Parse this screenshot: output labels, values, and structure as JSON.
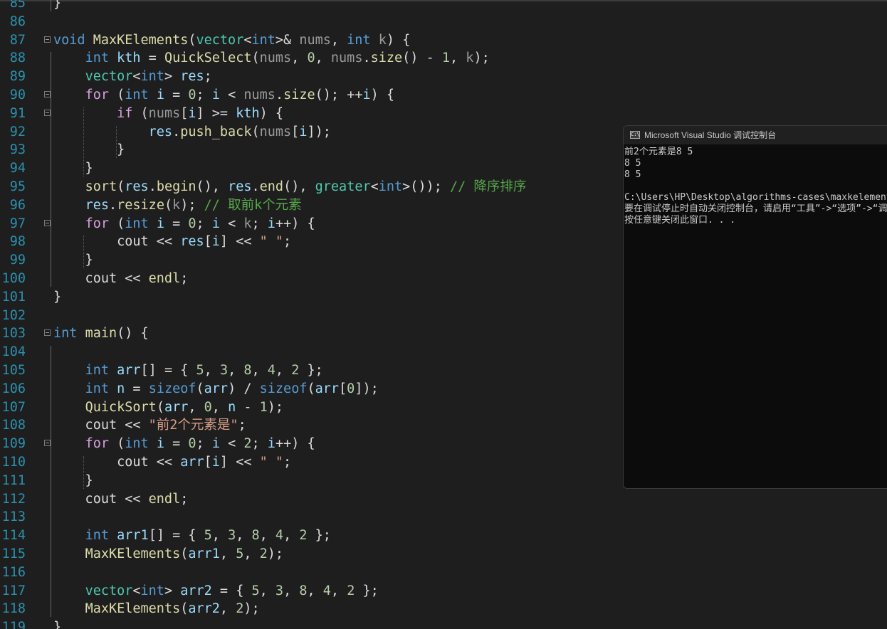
{
  "editor": {
    "line_numbers": [
      "85",
      "86",
      "87",
      "88",
      "89",
      "90",
      "91",
      "92",
      "93",
      "94",
      "95",
      "96",
      "97",
      "98",
      "99",
      "100",
      "101",
      "102",
      "103",
      "104",
      "105",
      "106",
      "107",
      "108",
      "109",
      "110",
      "111",
      "112",
      "113",
      "114",
      "115",
      "116",
      "117",
      "118",
      "119"
    ],
    "lines": [
      [
        {
          "t": "}",
          "c": "plain"
        }
      ],
      [],
      [
        {
          "t": "void",
          "c": "kw"
        },
        {
          "t": " ",
          "c": "plain"
        },
        {
          "t": "MaxKElements",
          "c": "fn"
        },
        {
          "t": "(",
          "c": "plain"
        },
        {
          "t": "vector",
          "c": "ty"
        },
        {
          "t": "<",
          "c": "plain"
        },
        {
          "t": "int",
          "c": "kw"
        },
        {
          "t": ">& ",
          "c": "plain"
        },
        {
          "t": "nums",
          "c": "prm"
        },
        {
          "t": ", ",
          "c": "plain"
        },
        {
          "t": "int",
          "c": "kw"
        },
        {
          "t": " ",
          "c": "plain"
        },
        {
          "t": "k",
          "c": "prm"
        },
        {
          "t": ") {",
          "c": "plain"
        }
      ],
      [
        {
          "t": "    ",
          "c": "plain"
        },
        {
          "t": "int",
          "c": "kw"
        },
        {
          "t": " ",
          "c": "plain"
        },
        {
          "t": "kth",
          "c": "var"
        },
        {
          "t": " = ",
          "c": "plain"
        },
        {
          "t": "QuickSelect",
          "c": "fn"
        },
        {
          "t": "(",
          "c": "plain"
        },
        {
          "t": "nums",
          "c": "prm"
        },
        {
          "t": ", ",
          "c": "plain"
        },
        {
          "t": "0",
          "c": "num"
        },
        {
          "t": ", ",
          "c": "plain"
        },
        {
          "t": "nums",
          "c": "prm"
        },
        {
          "t": ".",
          "c": "plain"
        },
        {
          "t": "size",
          "c": "fn"
        },
        {
          "t": "() - ",
          "c": "plain"
        },
        {
          "t": "1",
          "c": "num"
        },
        {
          "t": ", ",
          "c": "plain"
        },
        {
          "t": "k",
          "c": "prm"
        },
        {
          "t": ");",
          "c": "plain"
        }
      ],
      [
        {
          "t": "    ",
          "c": "plain"
        },
        {
          "t": "vector",
          "c": "ty"
        },
        {
          "t": "<",
          "c": "plain"
        },
        {
          "t": "int",
          "c": "kw"
        },
        {
          "t": "> ",
          "c": "plain"
        },
        {
          "t": "res",
          "c": "var"
        },
        {
          "t": ";",
          "c": "plain"
        }
      ],
      [
        {
          "t": "    ",
          "c": "plain"
        },
        {
          "t": "for",
          "c": "kwc"
        },
        {
          "t": " (",
          "c": "plain"
        },
        {
          "t": "int",
          "c": "kw"
        },
        {
          "t": " ",
          "c": "plain"
        },
        {
          "t": "i",
          "c": "var"
        },
        {
          "t": " = ",
          "c": "plain"
        },
        {
          "t": "0",
          "c": "num"
        },
        {
          "t": "; ",
          "c": "plain"
        },
        {
          "t": "i",
          "c": "var"
        },
        {
          "t": " < ",
          "c": "plain"
        },
        {
          "t": "nums",
          "c": "prm"
        },
        {
          "t": ".",
          "c": "plain"
        },
        {
          "t": "size",
          "c": "fn"
        },
        {
          "t": "(); ++",
          "c": "plain"
        },
        {
          "t": "i",
          "c": "var"
        },
        {
          "t": ") {",
          "c": "plain"
        }
      ],
      [
        {
          "t": "        ",
          "c": "plain"
        },
        {
          "t": "if",
          "c": "kwc"
        },
        {
          "t": " (",
          "c": "plain"
        },
        {
          "t": "nums",
          "c": "prm"
        },
        {
          "t": "[",
          "c": "plain"
        },
        {
          "t": "i",
          "c": "var"
        },
        {
          "t": "] >= ",
          "c": "plain"
        },
        {
          "t": "kth",
          "c": "var"
        },
        {
          "t": ") {",
          "c": "plain"
        }
      ],
      [
        {
          "t": "            ",
          "c": "plain"
        },
        {
          "t": "res",
          "c": "var"
        },
        {
          "t": ".",
          "c": "plain"
        },
        {
          "t": "push_back",
          "c": "fn"
        },
        {
          "t": "(",
          "c": "plain"
        },
        {
          "t": "nums",
          "c": "prm"
        },
        {
          "t": "[",
          "c": "plain"
        },
        {
          "t": "i",
          "c": "var"
        },
        {
          "t": "]);",
          "c": "plain"
        }
      ],
      [
        {
          "t": "        }",
          "c": "plain"
        }
      ],
      [
        {
          "t": "    }",
          "c": "plain"
        }
      ],
      [
        {
          "t": "    ",
          "c": "plain"
        },
        {
          "t": "sort",
          "c": "fn"
        },
        {
          "t": "(",
          "c": "plain"
        },
        {
          "t": "res",
          "c": "var"
        },
        {
          "t": ".",
          "c": "plain"
        },
        {
          "t": "begin",
          "c": "fn"
        },
        {
          "t": "(), ",
          "c": "plain"
        },
        {
          "t": "res",
          "c": "var"
        },
        {
          "t": ".",
          "c": "plain"
        },
        {
          "t": "end",
          "c": "fn"
        },
        {
          "t": "(), ",
          "c": "plain"
        },
        {
          "t": "greater",
          "c": "ty"
        },
        {
          "t": "<",
          "c": "plain"
        },
        {
          "t": "int",
          "c": "kw"
        },
        {
          "t": ">()); ",
          "c": "plain"
        },
        {
          "t": "// 降序排序",
          "c": "cm"
        }
      ],
      [
        {
          "t": "    ",
          "c": "plain"
        },
        {
          "t": "res",
          "c": "var"
        },
        {
          "t": ".",
          "c": "plain"
        },
        {
          "t": "resize",
          "c": "fn"
        },
        {
          "t": "(",
          "c": "plain"
        },
        {
          "t": "k",
          "c": "prm"
        },
        {
          "t": "); ",
          "c": "plain"
        },
        {
          "t": "// 取前k个元素",
          "c": "cm"
        }
      ],
      [
        {
          "t": "    ",
          "c": "plain"
        },
        {
          "t": "for",
          "c": "kwc"
        },
        {
          "t": " (",
          "c": "plain"
        },
        {
          "t": "int",
          "c": "kw"
        },
        {
          "t": " ",
          "c": "plain"
        },
        {
          "t": "i",
          "c": "var"
        },
        {
          "t": " = ",
          "c": "plain"
        },
        {
          "t": "0",
          "c": "num"
        },
        {
          "t": "; ",
          "c": "plain"
        },
        {
          "t": "i",
          "c": "var"
        },
        {
          "t": " < ",
          "c": "plain"
        },
        {
          "t": "k",
          "c": "prm"
        },
        {
          "t": "; ",
          "c": "plain"
        },
        {
          "t": "i",
          "c": "var"
        },
        {
          "t": "++) {",
          "c": "plain"
        }
      ],
      [
        {
          "t": "        cout << ",
          "c": "plain"
        },
        {
          "t": "res",
          "c": "var"
        },
        {
          "t": "[",
          "c": "plain"
        },
        {
          "t": "i",
          "c": "var"
        },
        {
          "t": "] << ",
          "c": "plain"
        },
        {
          "t": "\" \"",
          "c": "str"
        },
        {
          "t": ";",
          "c": "plain"
        }
      ],
      [
        {
          "t": "    }",
          "c": "plain"
        }
      ],
      [
        {
          "t": "    cout << ",
          "c": "plain"
        },
        {
          "t": "endl",
          "c": "fn"
        },
        {
          "t": ";",
          "c": "plain"
        }
      ],
      [
        {
          "t": "}",
          "c": "plain"
        }
      ],
      [],
      [
        {
          "t": "int",
          "c": "kw"
        },
        {
          "t": " ",
          "c": "plain"
        },
        {
          "t": "main",
          "c": "fn"
        },
        {
          "t": "() {",
          "c": "plain"
        }
      ],
      [],
      [
        {
          "t": "    ",
          "c": "plain"
        },
        {
          "t": "int",
          "c": "kw"
        },
        {
          "t": " ",
          "c": "plain"
        },
        {
          "t": "arr",
          "c": "var"
        },
        {
          "t": "[] = { ",
          "c": "plain"
        },
        {
          "t": "5",
          "c": "num"
        },
        {
          "t": ", ",
          "c": "plain"
        },
        {
          "t": "3",
          "c": "num"
        },
        {
          "t": ", ",
          "c": "plain"
        },
        {
          "t": "8",
          "c": "num"
        },
        {
          "t": ", ",
          "c": "plain"
        },
        {
          "t": "4",
          "c": "num"
        },
        {
          "t": ", ",
          "c": "plain"
        },
        {
          "t": "2",
          "c": "num"
        },
        {
          "t": " };",
          "c": "plain"
        }
      ],
      [
        {
          "t": "    ",
          "c": "plain"
        },
        {
          "t": "int",
          "c": "kw"
        },
        {
          "t": " ",
          "c": "plain"
        },
        {
          "t": "n",
          "c": "var"
        },
        {
          "t": " = ",
          "c": "plain"
        },
        {
          "t": "sizeof",
          "c": "kw"
        },
        {
          "t": "(",
          "c": "plain"
        },
        {
          "t": "arr",
          "c": "var"
        },
        {
          "t": ") / ",
          "c": "plain"
        },
        {
          "t": "sizeof",
          "c": "kw"
        },
        {
          "t": "(",
          "c": "plain"
        },
        {
          "t": "arr",
          "c": "var"
        },
        {
          "t": "[",
          "c": "plain"
        },
        {
          "t": "0",
          "c": "num"
        },
        {
          "t": "]);",
          "c": "plain"
        }
      ],
      [
        {
          "t": "    ",
          "c": "plain"
        },
        {
          "t": "QuickSort",
          "c": "fn"
        },
        {
          "t": "(",
          "c": "plain"
        },
        {
          "t": "arr",
          "c": "var"
        },
        {
          "t": ", ",
          "c": "plain"
        },
        {
          "t": "0",
          "c": "num"
        },
        {
          "t": ", ",
          "c": "plain"
        },
        {
          "t": "n",
          "c": "var"
        },
        {
          "t": " - ",
          "c": "plain"
        },
        {
          "t": "1",
          "c": "num"
        },
        {
          "t": ");",
          "c": "plain"
        }
      ],
      [
        {
          "t": "    cout << ",
          "c": "plain"
        },
        {
          "t": "\"前2个元素是\"",
          "c": "str"
        },
        {
          "t": ";",
          "c": "plain"
        }
      ],
      [
        {
          "t": "    ",
          "c": "plain"
        },
        {
          "t": "for",
          "c": "kwc"
        },
        {
          "t": " (",
          "c": "plain"
        },
        {
          "t": "int",
          "c": "kw"
        },
        {
          "t": " ",
          "c": "plain"
        },
        {
          "t": "i",
          "c": "var"
        },
        {
          "t": " = ",
          "c": "plain"
        },
        {
          "t": "0",
          "c": "num"
        },
        {
          "t": "; ",
          "c": "plain"
        },
        {
          "t": "i",
          "c": "var"
        },
        {
          "t": " < ",
          "c": "plain"
        },
        {
          "t": "2",
          "c": "num"
        },
        {
          "t": "; ",
          "c": "plain"
        },
        {
          "t": "i",
          "c": "var"
        },
        {
          "t": "++) {",
          "c": "plain"
        }
      ],
      [
        {
          "t": "        cout << ",
          "c": "plain"
        },
        {
          "t": "arr",
          "c": "var"
        },
        {
          "t": "[",
          "c": "plain"
        },
        {
          "t": "i",
          "c": "var"
        },
        {
          "t": "] << ",
          "c": "plain"
        },
        {
          "t": "\" \"",
          "c": "str"
        },
        {
          "t": ";",
          "c": "plain"
        }
      ],
      [
        {
          "t": "    }",
          "c": "plain"
        }
      ],
      [
        {
          "t": "    cout << ",
          "c": "plain"
        },
        {
          "t": "endl",
          "c": "fn"
        },
        {
          "t": ";",
          "c": "plain"
        }
      ],
      [],
      [
        {
          "t": "    ",
          "c": "plain"
        },
        {
          "t": "int",
          "c": "kw"
        },
        {
          "t": " ",
          "c": "plain"
        },
        {
          "t": "arr1",
          "c": "var"
        },
        {
          "t": "[] = { ",
          "c": "plain"
        },
        {
          "t": "5",
          "c": "num"
        },
        {
          "t": ", ",
          "c": "plain"
        },
        {
          "t": "3",
          "c": "num"
        },
        {
          "t": ", ",
          "c": "plain"
        },
        {
          "t": "8",
          "c": "num"
        },
        {
          "t": ", ",
          "c": "plain"
        },
        {
          "t": "4",
          "c": "num"
        },
        {
          "t": ", ",
          "c": "plain"
        },
        {
          "t": "2",
          "c": "num"
        },
        {
          "t": " };",
          "c": "plain"
        }
      ],
      [
        {
          "t": "    ",
          "c": "plain"
        },
        {
          "t": "MaxKElements",
          "c": "fn"
        },
        {
          "t": "(",
          "c": "plain"
        },
        {
          "t": "arr1",
          "c": "var"
        },
        {
          "t": ", ",
          "c": "plain"
        },
        {
          "t": "5",
          "c": "num"
        },
        {
          "t": ", ",
          "c": "plain"
        },
        {
          "t": "2",
          "c": "num"
        },
        {
          "t": ");",
          "c": "plain"
        }
      ],
      [],
      [
        {
          "t": "    ",
          "c": "plain"
        },
        {
          "t": "vector",
          "c": "ty"
        },
        {
          "t": "<",
          "c": "plain"
        },
        {
          "t": "int",
          "c": "kw"
        },
        {
          "t": "> ",
          "c": "plain"
        },
        {
          "t": "arr2",
          "c": "var"
        },
        {
          "t": " = { ",
          "c": "plain"
        },
        {
          "t": "5",
          "c": "num"
        },
        {
          "t": ", ",
          "c": "plain"
        },
        {
          "t": "3",
          "c": "num"
        },
        {
          "t": ", ",
          "c": "plain"
        },
        {
          "t": "8",
          "c": "num"
        },
        {
          "t": ", ",
          "c": "plain"
        },
        {
          "t": "4",
          "c": "num"
        },
        {
          "t": ", ",
          "c": "plain"
        },
        {
          "t": "2",
          "c": "num"
        },
        {
          "t": " };",
          "c": "plain"
        }
      ],
      [
        {
          "t": "    ",
          "c": "plain"
        },
        {
          "t": "MaxKElements",
          "c": "fn"
        },
        {
          "t": "(",
          "c": "plain"
        },
        {
          "t": "arr2",
          "c": "var"
        },
        {
          "t": ", ",
          "c": "plain"
        },
        {
          "t": "2",
          "c": "num"
        },
        {
          "t": ");",
          "c": "plain"
        }
      ],
      [
        {
          "t": "}",
          "c": "plain"
        }
      ]
    ]
  },
  "console": {
    "icon_text": "C:\\",
    "title": "Microsoft Visual Studio 调试控制台",
    "lines": [
      "前2个元素是8 5",
      "8 5",
      "8 5",
      "",
      "C:\\Users\\HP\\Desktop\\algorithms-cases\\maxkelements",
      "要在调试停止时自动关闭控制台，请启用“工具”->“选项”->“调试”->“调试停止时自动关闭控制台”。",
      "按任意键关闭此窗口. . ."
    ]
  },
  "colors": {
    "background": "#1e1e1e",
    "line_number": "#2b91af",
    "keyword": "#569cd6",
    "control_keyword": "#d8a0df",
    "function": "#dcdcaa",
    "type": "#4ec9b0",
    "variable": "#9cdcfe",
    "parameter": "#9a9a9a",
    "number": "#b5cea8",
    "string": "#d69d85",
    "comment": "#57a64a",
    "console_background": "#0c0c0c"
  },
  "icons": {
    "fold": "collapse-box-icon",
    "console": "console-app-icon"
  }
}
